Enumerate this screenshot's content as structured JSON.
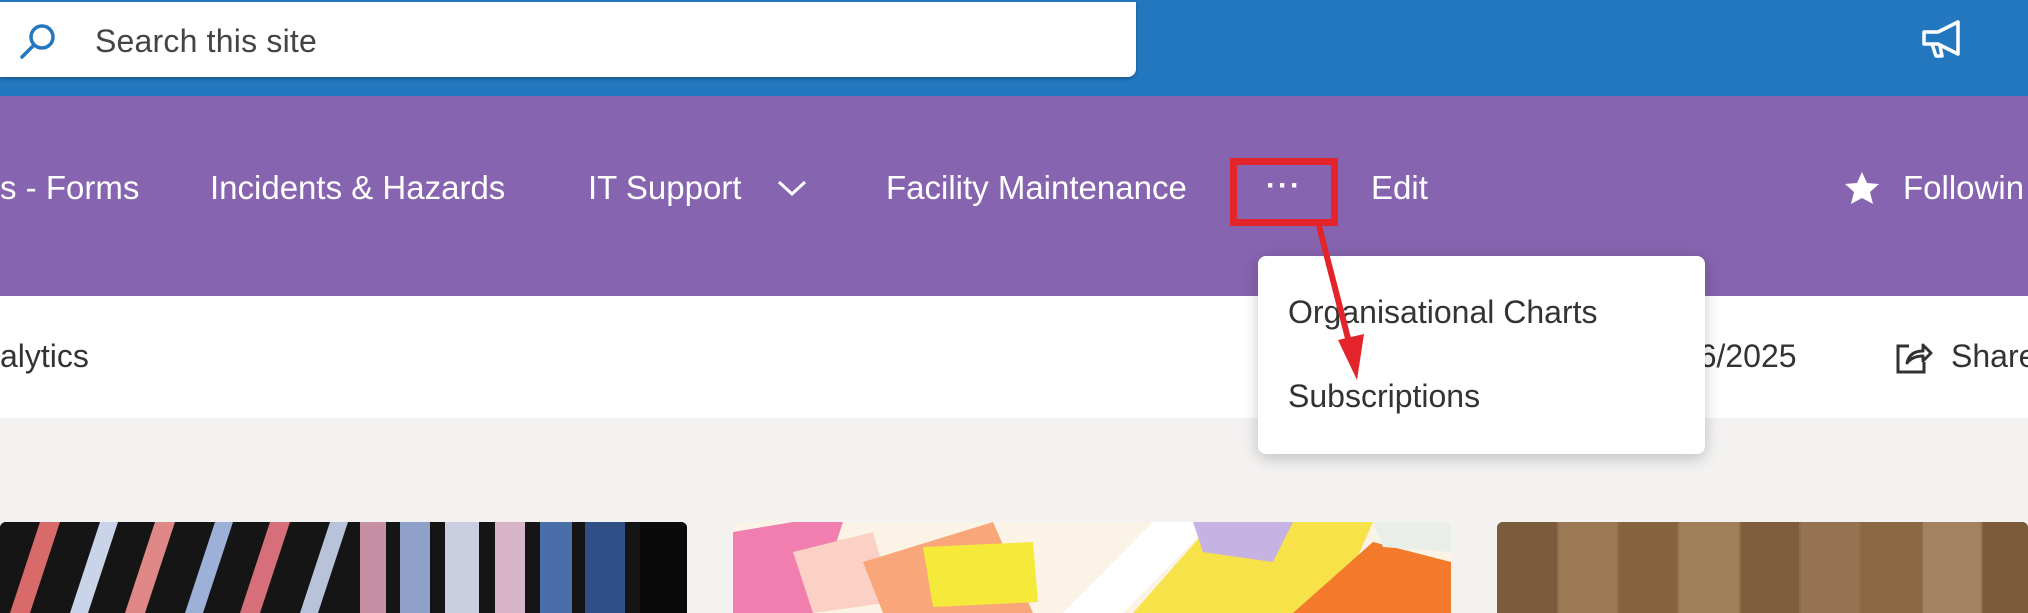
{
  "search": {
    "placeholder": "Search this site"
  },
  "nav": {
    "items": [
      {
        "label": "s - Forms"
      },
      {
        "label": "Incidents & Hazards"
      },
      {
        "label": "IT Support"
      },
      {
        "label": "Facility Maintenance"
      },
      {
        "label": "Edit"
      }
    ],
    "more_label": "···",
    "following_label": "Followin"
  },
  "command_bar": {
    "left_text": "alytics",
    "date_text": "/26/2025",
    "share_label": "Share"
  },
  "dropdown": {
    "items": [
      {
        "label": "Organisational Charts"
      },
      {
        "label": "Subscriptions"
      }
    ]
  },
  "colors": {
    "suite_bar": "#2277be",
    "hub_nav": "#8764b0",
    "highlight": "#e3242b"
  },
  "icons": [
    "search-icon",
    "megaphone-icon",
    "chevron-down-icon",
    "more-icon",
    "star-icon",
    "share-icon"
  ]
}
